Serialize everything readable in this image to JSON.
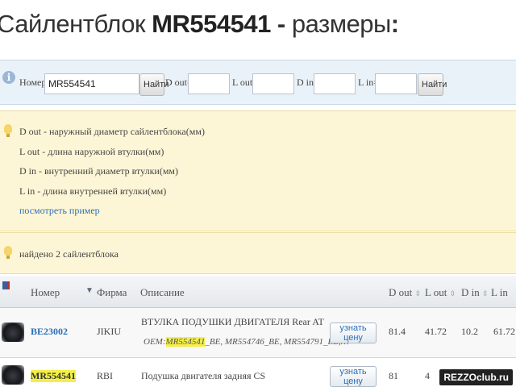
{
  "title": {
    "prefix": "Сайлентблок ",
    "part_number": "MR554541",
    "dash": " - ",
    "suffix": "размеры",
    "colon": ":"
  },
  "search": {
    "info_icon": "i",
    "number_label": "Номер",
    "number_value": "MR554541",
    "find_label": "Найти",
    "d_out_label": "D out=",
    "d_out_value": "",
    "l_out_label": "L out=",
    "l_out_value": "",
    "d_in_label": "D in=",
    "d_in_value": "",
    "l_in_label": "L in=",
    "l_in_value": "",
    "find_label_2": "Найти"
  },
  "legend": {
    "lines": [
      "D out - наружный диаметр сайлентблока(мм)",
      "L out - длина наружной втулки(мм)",
      "D in - внутренний диаметр втулки(мм)",
      "L in - длина внутренней втулки(мм)"
    ],
    "example_link": "посмотреть пример"
  },
  "found": {
    "text": "найдено 2 сайлентблока"
  },
  "table": {
    "columns": {
      "number": "Номер",
      "brand": "Фирма",
      "description": "Описание",
      "d_out": "D out",
      "l_out": "L out",
      "d_in": "D in",
      "l_in": "L in"
    },
    "rows": [
      {
        "number": "BE23002",
        "brand": "JIKIU",
        "description": "ВТУЛКА ПОДУШКИ ДВИГАТЕЛЯ Rear AT",
        "oem_prefix": "OEM:",
        "oem_highlight": "MR554541",
        "oem_rest": "_BE, MR554746_BE, MR554791_BE,…",
        "button": "узнать цену",
        "d_out": "81.4",
        "l_out": "41.72",
        "d_in": "10.2",
        "l_in": "61.72"
      },
      {
        "number": "MR554541",
        "brand": "RBI",
        "description": "Подушка двигателя задняя CS",
        "button": "узнать цену",
        "d_out": "81",
        "l_out": "4",
        "d_in": "",
        "l_in": ""
      }
    ]
  },
  "watermark": "REZZOclub.ru",
  "colors": {
    "link": "#2a6fb8",
    "highlight": "#f3ef48",
    "notice_bg": "#fdf6d6",
    "search_bg": "#eaf2f9"
  }
}
